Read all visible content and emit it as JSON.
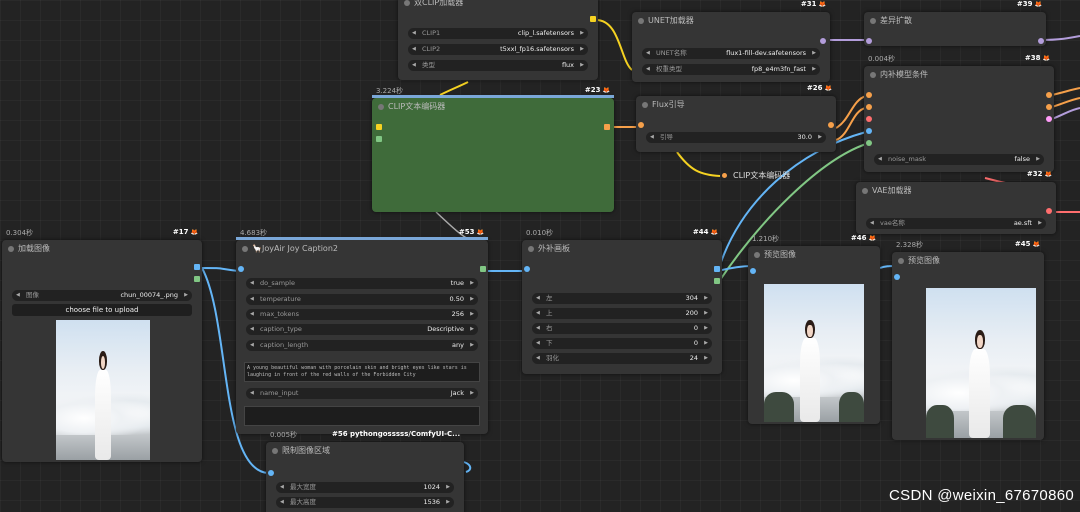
{
  "colors": {
    "node_bg": "#353535",
    "green_node": "#3f6b3a",
    "clip_yellow": "#f5d222",
    "image_blue": "#64b5f6",
    "conditioning_orange": "#f6a04a",
    "mask_green": "#81c784",
    "model_purple": "#b39ddb",
    "vae_red": "#ff6e6e"
  },
  "nodes": {
    "clip_loader": {
      "title": "双CLIP加载器",
      "w1_k": "CLIP1",
      "w1_v": "clip_l.safetensors",
      "w2_k": "CLIP2",
      "w2_v": "t5xxl_fp16.safetensors",
      "w3_k": "类型",
      "w3_v": "flux"
    },
    "unet": {
      "id": "#31",
      "title": "UNET加载器",
      "w1_k": "UNET名称",
      "w1_v": "flux1-fill-dev.safetensors",
      "w2_k": "权重类型",
      "w2_v": "fp8_e4m3fn_fast"
    },
    "diffdiff": {
      "id": "#39",
      "title": "差异扩散"
    },
    "inpaint_cond": {
      "id": "#38",
      "time": "0.004秒",
      "title": "内补模型条件",
      "w1_k": "noise_mask",
      "w1_v": "false"
    },
    "vae": {
      "id": "#32",
      "title": "VAE加载器",
      "w1_k": "vae名称",
      "w1_v": "ae.sft"
    },
    "clip_text": {
      "id": "#23",
      "time": "3.224秒",
      "title": "CLIP文本编码器"
    },
    "flux_guidance": {
      "id": "#26",
      "title": "Flux引导",
      "w1_k": "引导",
      "w1_v": "30.0"
    },
    "clip_text_collapsed": {
      "title": "CLIP文本编码器"
    },
    "load_image": {
      "id": "#17",
      "time": "0.304秒",
      "title": "加载图像",
      "w1_k": "图像",
      "w1_v": "chun_00074_.png",
      "upload": "choose file to upload"
    },
    "joy_caption": {
      "id": "#53",
      "time": "4.683秒",
      "title": "🦙JoyAir Joy Caption2",
      "w1_k": "do_sample",
      "w1_v": "true",
      "w2_k": "temperature",
      "w2_v": "0.50",
      "w3_k": "max_tokens",
      "w3_v": "256",
      "w4_k": "caption_type",
      "w4_v": "Descriptive",
      "w5_k": "caption_length",
      "w5_v": "any",
      "caption": "A young beautiful woman with porcelain skin and bright eyes like stars is laughing in front of the red walls of the Forbidden City",
      "w6_k": "name_input",
      "w6_v": "Jack"
    },
    "pad": {
      "id": "#44",
      "time": "0.010秒",
      "title": "外补画板",
      "w1_k": "左",
      "w1_v": "304",
      "w2_k": "上",
      "w2_v": "200",
      "w3_k": "右",
      "w3_v": "0",
      "w4_k": "下",
      "w4_v": "0",
      "w5_k": "羽化",
      "w5_v": "24"
    },
    "preview1": {
      "id": "#46",
      "time": "1.210秒",
      "title": "预览图像"
    },
    "preview2": {
      "id": "#45",
      "time": "2.328秒",
      "title": "预览图像"
    },
    "limit": {
      "id": "#56 pythongosssss/ComfyUI-C...",
      "time": "0.005秒",
      "title": "限制图像区域",
      "w1_k": "最大宽度",
      "w1_v": "1024",
      "w2_k": "最大高度",
      "w2_v": "1536"
    }
  },
  "watermark": "CSDN @weixin_67670860"
}
